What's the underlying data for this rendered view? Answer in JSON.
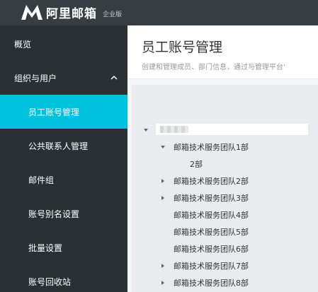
{
  "app": {
    "brand": "阿里邮箱",
    "edition": "企业版"
  },
  "sidebar": {
    "items": [
      {
        "label": "概览"
      },
      {
        "label": "组织与用户"
      },
      {
        "label": "员工账号管理"
      },
      {
        "label": "公共联系人管理"
      },
      {
        "label": "邮件组"
      },
      {
        "label": "账号别名设置"
      },
      {
        "label": "批量设置"
      },
      {
        "label": "账号回收站"
      }
    ]
  },
  "page": {
    "title": "员工账号管理",
    "description": "创建和管理成员、部门信息，通过与管理平台'"
  },
  "tree": {
    "nodes": [
      {
        "label": "邮箱技术服务团队1部"
      },
      {
        "label": "2部"
      },
      {
        "label": "邮箱技术服务团队2部"
      },
      {
        "label": "邮箱技术服务团队3部"
      },
      {
        "label": "邮箱技术服务团队4部"
      },
      {
        "label": "邮箱技术服务团队5部"
      },
      {
        "label": "邮箱技术服务团队6部"
      },
      {
        "label": "邮箱技术服务团队7部"
      },
      {
        "label": "邮箱技术服务团队8部"
      }
    ]
  },
  "colors": {
    "topbar": "#373d41",
    "sidebar": "#2b3035",
    "accent": "#00c1de"
  },
  "icons": {
    "logo": "mail-logo-icon",
    "collapse": "chevron-up-icon",
    "expanded": "triangle-down-icon",
    "collapsed": "triangle-right-icon"
  }
}
